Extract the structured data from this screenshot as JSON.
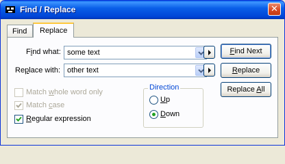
{
  "window": {
    "title": "Find / Replace",
    "close_glyph": "✕"
  },
  "tabs": [
    {
      "label": "Find",
      "active": false
    },
    {
      "label": "Replace",
      "active": true
    }
  ],
  "find": {
    "label_pre": "F",
    "label_ul": "i",
    "label_post": "nd what:",
    "value": "some text"
  },
  "replace": {
    "label_pre": "Re",
    "label_ul": "p",
    "label_post": "lace with:",
    "value": "other text"
  },
  "buttons": {
    "find_next": {
      "pre": "",
      "ul": "F",
      "post": "ind Next"
    },
    "replace": {
      "pre": "",
      "ul": "R",
      "post": "eplace"
    },
    "replace_all": {
      "pre": "Replace ",
      "ul": "A",
      "post": "ll"
    }
  },
  "options": {
    "whole_word": {
      "pre": "Match ",
      "ul": "w",
      "post": "hole word only",
      "checked": false,
      "enabled": false
    },
    "match_case": {
      "pre": "Match ",
      "ul": "c",
      "post": "ase",
      "checked": true,
      "enabled": false
    },
    "regex": {
      "pre": "",
      "ul": "R",
      "post": "egular expression",
      "checked": true,
      "enabled": true
    }
  },
  "direction": {
    "title": "Direction",
    "up": {
      "ul": "U",
      "post": "p",
      "selected": false
    },
    "down": {
      "ul": "D",
      "post": "own",
      "selected": true
    }
  },
  "colors": {
    "title_bar": "#0a5fe8",
    "radio_dot": "#21a121",
    "check": "#21a121",
    "group_title": "#0046d5",
    "tab_highlight": "#ffc83c"
  }
}
